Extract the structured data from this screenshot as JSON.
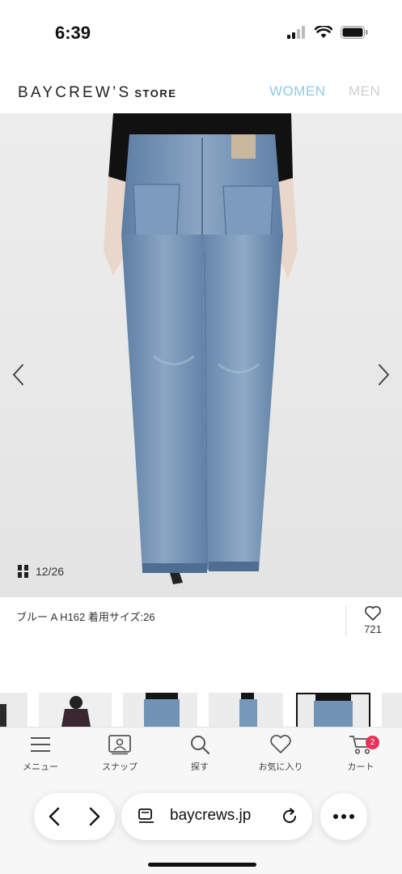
{
  "status_bar": {
    "time": "6:39"
  },
  "header": {
    "logo": "BAYCREW’S",
    "logo_suffix": "STORE",
    "nav": {
      "women": "WOMEN",
      "men": "MEN"
    }
  },
  "gallery": {
    "counter": "12/26",
    "caption": "ブルー A H162 着用サイズ:26",
    "favorite_count": "721"
  },
  "tabbar": {
    "menu": "メニュー",
    "snap": "スナップ",
    "search": "探す",
    "favorites": "お気に入り",
    "cart": "カート",
    "cart_badge": "2"
  },
  "browser": {
    "url": "baycrews.jp"
  },
  "colors": {
    "accent_women": "#8ecae8",
    "badge": "#e8305a",
    "denim": "#6f8fb3"
  }
}
